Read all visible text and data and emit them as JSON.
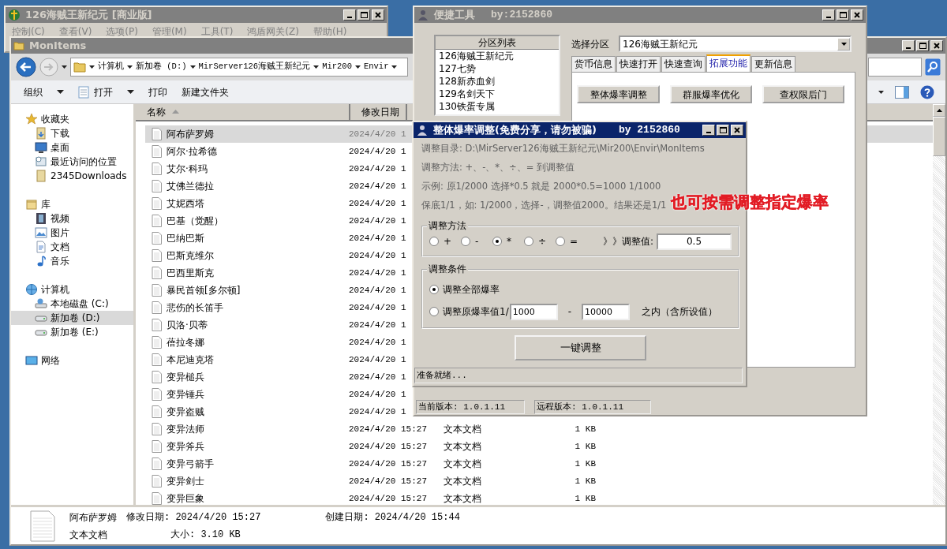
{
  "back_window": {
    "title": "126海贼王新纪元 [商业版]",
    "active": false,
    "menu": [
      "控制(C)",
      "查看(V)",
      "选项(P)",
      "管理(M)",
      "工具(T)",
      "鸿盾网关(Z)",
      "帮助(H)"
    ]
  },
  "explorer": {
    "title": "MonItems",
    "active": false,
    "breadcrumb": [
      "计算机",
      "新加卷 (D:)",
      "MirServer126海贼王新纪元",
      "Mir200",
      "Envir"
    ],
    "toolbar": [
      {
        "label": "组织",
        "dropdown": true
      },
      {
        "label": "打开",
        "dropdown": true
      },
      {
        "label": "打印",
        "dropdown": false
      },
      {
        "label": "新建文件夹",
        "dropdown": false
      }
    ],
    "nav": [
      {
        "label": "收藏夹",
        "selected": false,
        "children": [
          {
            "label": "下载",
            "selected": false
          },
          {
            "label": "桌面",
            "selected": false
          },
          {
            "label": "最近访问的位置",
            "selected": false
          },
          {
            "label": "2345Downloads",
            "selected": false
          }
        ]
      },
      {
        "label": "库",
        "selected": false,
        "children": [
          {
            "label": "视频",
            "selected": false
          },
          {
            "label": "图片",
            "selected": false
          },
          {
            "label": "文档",
            "selected": false
          },
          {
            "label": "音乐",
            "selected": false
          }
        ]
      },
      {
        "label": "计算机",
        "selected": false,
        "children": [
          {
            "label": "本地磁盘 (C:)",
            "selected": false
          },
          {
            "label": "新加卷 (D:)",
            "selected": true
          },
          {
            "label": "新加卷 (E:)",
            "selected": false
          }
        ]
      },
      {
        "label": "网络",
        "selected": false
      }
    ],
    "columns": [
      "名称",
      "修改日期"
    ],
    "files": [
      {
        "name": "阿布萨罗姆",
        "date": "2024/4/20 1",
        "selected": true
      },
      {
        "name": "阿尔·拉希德",
        "date": "2024/4/20 1",
        "selected": false
      },
      {
        "name": "艾尔·科玛",
        "date": "2024/4/20 1",
        "selected": false
      },
      {
        "name": "艾佛兰德拉",
        "date": "2024/4/20 1",
        "selected": false
      },
      {
        "name": "艾妮西塔",
        "date": "2024/4/20 1",
        "selected": false
      },
      {
        "name": "巴基（觉醒）",
        "date": "2024/4/20 1",
        "selected": false
      },
      {
        "name": "巴纳巴斯",
        "date": "2024/4/20 1",
        "selected": false
      },
      {
        "name": "巴斯克维尔",
        "date": "2024/4/20 1",
        "selected": false
      },
      {
        "name": "巴西里斯克",
        "date": "2024/4/20 1",
        "selected": false
      },
      {
        "name": "暴民首领[多尔顿]",
        "date": "2024/4/20 1",
        "selected": false
      },
      {
        "name": "悲伤的长笛手",
        "date": "2024/4/20 1",
        "selected": false
      },
      {
        "name": "贝洛·贝蒂",
        "date": "2024/4/20 1",
        "selected": false
      },
      {
        "name": "蓓拉冬娜",
        "date": "2024/4/20 1",
        "selected": false
      },
      {
        "name": "本尼迪克塔",
        "date": "2024/4/20 1",
        "selected": false
      },
      {
        "name": "变异槌兵",
        "date": "2024/4/20 1",
        "selected": false
      },
      {
        "name": "变异锤兵",
        "date": "2024/4/20 1",
        "selected": false
      },
      {
        "name": "变异盗贼",
        "date": "2024/4/20 1",
        "selected": false
      },
      {
        "name": "变异法师",
        "date": "2024/4/20 15:27",
        "type": "文本文档",
        "size": "1 KB",
        "selected": false
      },
      {
        "name": "变异斧兵",
        "date": "2024/4/20 15:27",
        "type": "文本文档",
        "size": "1 KB",
        "selected": false
      },
      {
        "name": "变异弓箭手",
        "date": "2024/4/20 15:27",
        "type": "文本文档",
        "size": "1 KB",
        "selected": false
      },
      {
        "name": "变异剑士",
        "date": "2024/4/20 15:27",
        "type": "文本文档",
        "size": "1 KB",
        "selected": false
      },
      {
        "name": "变异巨象",
        "date": "2024/4/20 15:27",
        "type": "文本文档",
        "size": "1 KB",
        "selected": false
      }
    ],
    "details": {
      "name": "阿布萨罗姆",
      "modified": "修改日期: 2024/4/20 15:27",
      "created": "创建日期: 2024/4/20 15:44",
      "type": "文本文档",
      "size": "大小: 3.10 KB"
    }
  },
  "tool_window": {
    "title": "便捷工具",
    "author": "by:2152860",
    "active": false,
    "list_header": "分区列表",
    "partitions": [
      "126海贼王新纪元",
      "127七势",
      "128新赤血剑",
      "129名剑天下",
      "130铁蛋专属"
    ],
    "select_label": "选择分区",
    "select_value": "126海贼王新纪元",
    "tabs": [
      {
        "label": "货币信息",
        "selected": false
      },
      {
        "label": "快速打开",
        "selected": false
      },
      {
        "label": "快速查询",
        "selected": false
      },
      {
        "label": "拓展功能",
        "selected": true
      },
      {
        "label": "更新信息",
        "selected": false
      }
    ],
    "buttons": [
      "整体爆率调整",
      "群服爆率优化",
      "查权限后门"
    ],
    "status": [
      "当前版本: 1.0.1.11",
      "远程版本: 1.0.1.11"
    ]
  },
  "dialog": {
    "title": "整体爆率调整(免费分享，请勿被骗)",
    "author": "by 2152860",
    "active": true,
    "lines": [
      "调整目录: D:\\MirServer126海贼王新纪元\\Mir200\\Envir\\MonItems",
      "调整方法: +、-、*、÷、=   到调整值",
      "示例: 原1/2000 选择*0.5 就是 2000*0.5=1000  1/1000",
      "保底1/1，如: 1/2000，选择-，调整值2000。结果还是1/1"
    ],
    "method_group": "调整方法",
    "methods": [
      {
        "label": "+",
        "selected": false
      },
      {
        "label": "-",
        "selected": false
      },
      {
        "label": "*",
        "selected": true
      },
      {
        "label": "÷",
        "selected": false
      },
      {
        "label": "=",
        "selected": false
      }
    ],
    "value_label": "》》调整值:",
    "value": "0.5",
    "condition_group": "调整条件",
    "conditions": [
      {
        "kind": "all",
        "label": "调整全部爆率",
        "selected": true
      },
      {
        "kind": "range",
        "label": "调整原爆率值1/",
        "from": "1000",
        "dash": "-",
        "to": "10000",
        "suffix": "之内（含所设值）",
        "selected": false
      }
    ],
    "run_button": "一键调整",
    "status": "准备就绪..."
  },
  "annotation": "也可按需调整指定爆率"
}
